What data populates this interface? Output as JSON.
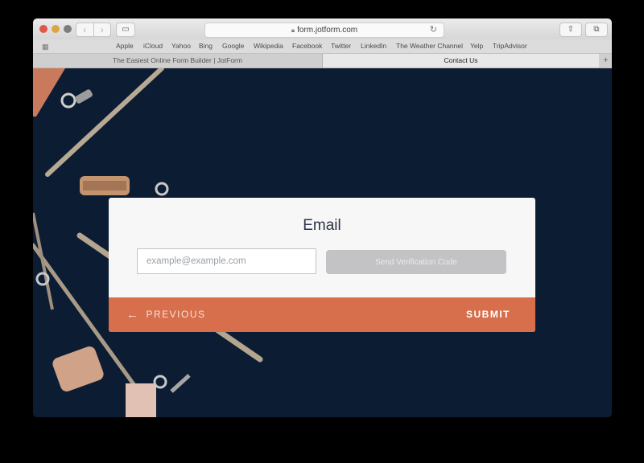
{
  "browser": {
    "address": "form.jotform.com",
    "favorites": [
      "Apple",
      "iCloud",
      "Yahoo",
      "Bing",
      "Google",
      "Wikipedia",
      "Facebook",
      "Twitter",
      "LinkedIn",
      "The Weather Channel",
      "Yelp",
      "TripAdvisor"
    ],
    "tabs": [
      "The Easiest Online Form Builder | JotForm",
      "Contact Us"
    ]
  },
  "form": {
    "title": "Email",
    "email_placeholder": "example@example.com",
    "verify_label": "Send Verification Code",
    "previous_label": "PREVIOUS",
    "submit_label": "SUBMIT"
  },
  "colors": {
    "page_background": "#0c1d33",
    "footer_accent": "#d76e4c",
    "verify_button": "#c3c3c6"
  }
}
